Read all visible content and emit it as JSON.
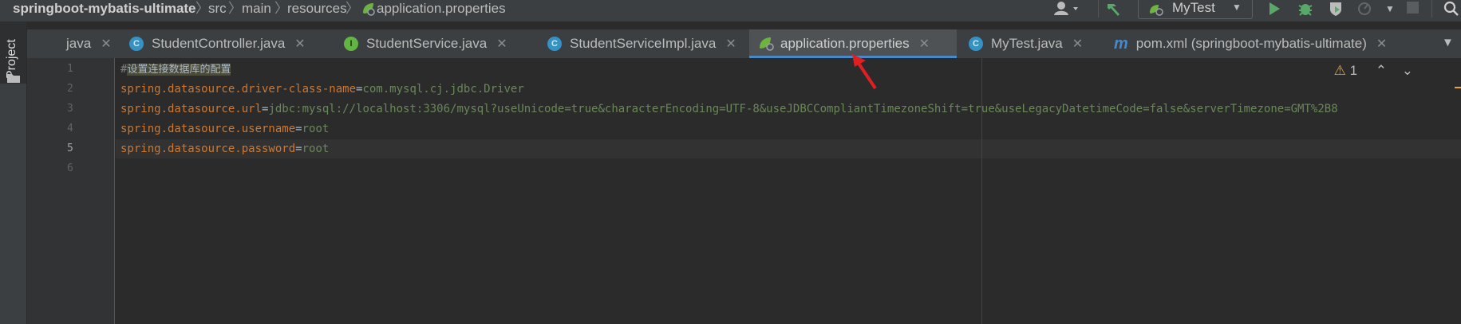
{
  "breadcrumb": {
    "project": "springboot-mybatis-ultimate",
    "items": [
      "src",
      "main",
      "resources",
      "application.properties"
    ]
  },
  "toolbar": {
    "run_config": "MyTest"
  },
  "sidebar": {
    "project_label": "Project"
  },
  "tabs": [
    {
      "label": "java",
      "icon": "none"
    },
    {
      "label": "StudentController.java",
      "icon": "class-icon",
      "badge": "C"
    },
    {
      "label": "StudentService.java",
      "icon": "interface-icon",
      "badge": "I"
    },
    {
      "label": "StudentServiceImpl.java",
      "icon": "class-icon",
      "badge": "C"
    },
    {
      "label": "application.properties",
      "icon": "spring-leaf-icon",
      "active": true
    },
    {
      "label": "MyTest.java",
      "icon": "test-class-icon",
      "badge": "C"
    },
    {
      "label": "pom.xml (springboot-mybatis-ultimate)",
      "icon": "maven-icon",
      "badge": "m"
    }
  ],
  "editor": {
    "line_numbers": [
      "1",
      "2",
      "3",
      "4",
      "5",
      "6"
    ],
    "comment": "设置连接数据库的配置",
    "lines": [
      {
        "key": "spring.datasource.driver-class-name",
        "value": "com.mysql.cj.jdbc.Driver"
      },
      {
        "key": "spring.datasource.url",
        "value": "jdbc:mysql://localhost:3306/mysql?useUnicode=true&characterEncoding=UTF-8&useJDBCCompliantTimezoneShift=true&useLegacyDatetimeCode=false&serverTimezone=GMT%2B8"
      },
      {
        "key": "spring.datasource.username",
        "value": "root"
      },
      {
        "key": "spring.datasource.password",
        "value": "root"
      }
    ],
    "warning_count": "1"
  },
  "colors": {
    "key": "#cc7832",
    "value": "#6a8759",
    "accent": "#4a88c7",
    "background": "#2b2b2b"
  }
}
